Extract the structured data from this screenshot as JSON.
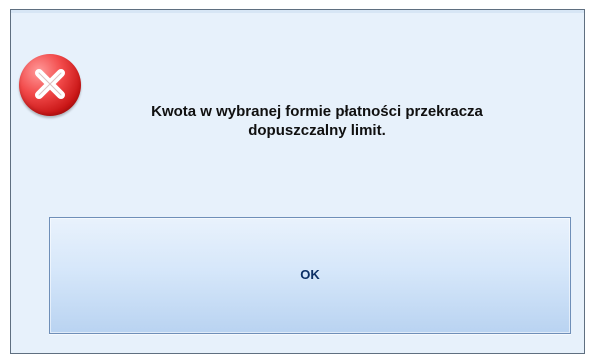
{
  "dialog": {
    "message": "Kwota w wybranej formie płatności przekracza dopuszczalny limit.",
    "ok_label": "OK",
    "icon": "error-icon"
  }
}
